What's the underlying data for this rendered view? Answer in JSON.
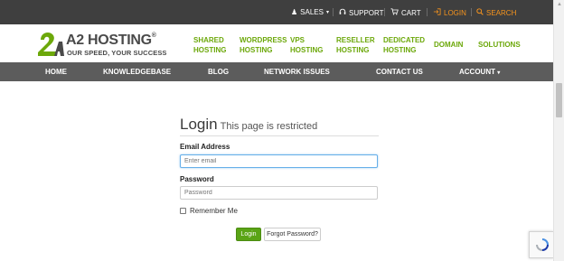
{
  "topbar": {
    "sales": "SALES",
    "support": "SUPPORT",
    "cart": "CART",
    "login": "LOGIN",
    "search": "SEARCH"
  },
  "logo": {
    "name": "A2 HOSTING",
    "tagline": "OUR SPEED, YOUR SUCCESS"
  },
  "main_nav": [
    {
      "line1": "SHARED",
      "line2": "HOSTING"
    },
    {
      "line1": "WORDPRESS",
      "line2": "HOSTING"
    },
    {
      "line1": "VPS",
      "line2": "HOSTING"
    },
    {
      "line1": "RESELLER",
      "line2": "HOSTING"
    },
    {
      "line1": "DEDICATED",
      "line2": "HOSTING"
    },
    {
      "line1": "DOMAIN",
      "line2": ""
    },
    {
      "line1": "SOLUTIONS",
      "line2": ""
    }
  ],
  "sub_nav": [
    "HOME",
    "KNOWLEDGEBASE",
    "BLOG",
    "NETWORK ISSUES",
    "CONTACT US",
    "ACCOUNT"
  ],
  "login": {
    "title": "Login",
    "subtitle": "This page is restricted",
    "email_label": "Email Address",
    "email_placeholder": "Enter email",
    "password_label": "Password",
    "password_placeholder": "Password",
    "remember_label": "Remember Me",
    "login_button": "Login",
    "forgot_button": "Forgot Password?"
  },
  "colors": {
    "brand_green": "#6ca80a",
    "accent_orange": "#f7941d",
    "topbar_bg": "#3f3f3f",
    "subnav_bg": "#5c5c5c"
  },
  "icons": [
    "user-icon",
    "chevron-down-icon",
    "headset-icon",
    "cart-icon",
    "login-icon",
    "search-icon"
  ]
}
